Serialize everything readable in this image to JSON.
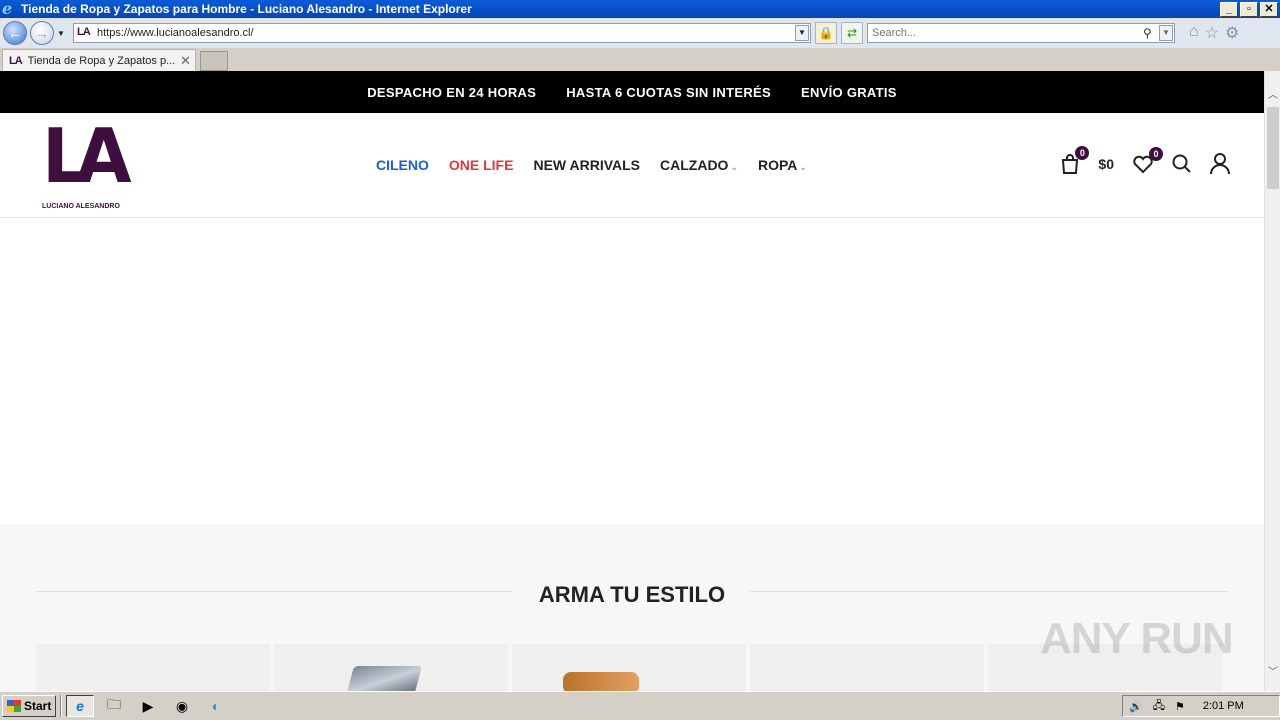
{
  "window": {
    "title": "Tienda de Ropa y Zapatos para Hombre - Luciano Alesandro - Internet Explorer",
    "minimize": "_",
    "restore": "▫",
    "close": "✕"
  },
  "address_bar": {
    "url": "https://www.lucianoalesandro.cl/",
    "favicon": "LA",
    "search_placeholder": "Search..."
  },
  "tab": {
    "favicon": "LA",
    "label": "Tienda de Ropa y Zapatos p...",
    "close": "✕"
  },
  "promo_bar": {
    "items": [
      "DESPACHO EN 24 HORAS",
      "HASTA 6 CUOTAS SIN INTERÉS",
      "ENVÍO GRATIS"
    ]
  },
  "header": {
    "logo_mark": "LA",
    "logo_text": "LUCIANO ALESANDRO",
    "nav": [
      {
        "label": "CILENO",
        "color": "#1a5ed6"
      },
      {
        "label": "ONE LIFE",
        "color": "#e5363a"
      },
      {
        "label": "NEW ARRIVALS"
      },
      {
        "label": "CALZADO",
        "has_dropdown": true
      },
      {
        "label": "ROPA",
        "has_dropdown": true
      }
    ],
    "cart_count": "0",
    "cart_total": "$0",
    "wishlist_count": "0"
  },
  "section": {
    "title": "ARMA TU ESTILO"
  },
  "taskbar": {
    "start_label": "Start",
    "clock": "2:01 PM"
  },
  "watermark": "ANY RUN"
}
